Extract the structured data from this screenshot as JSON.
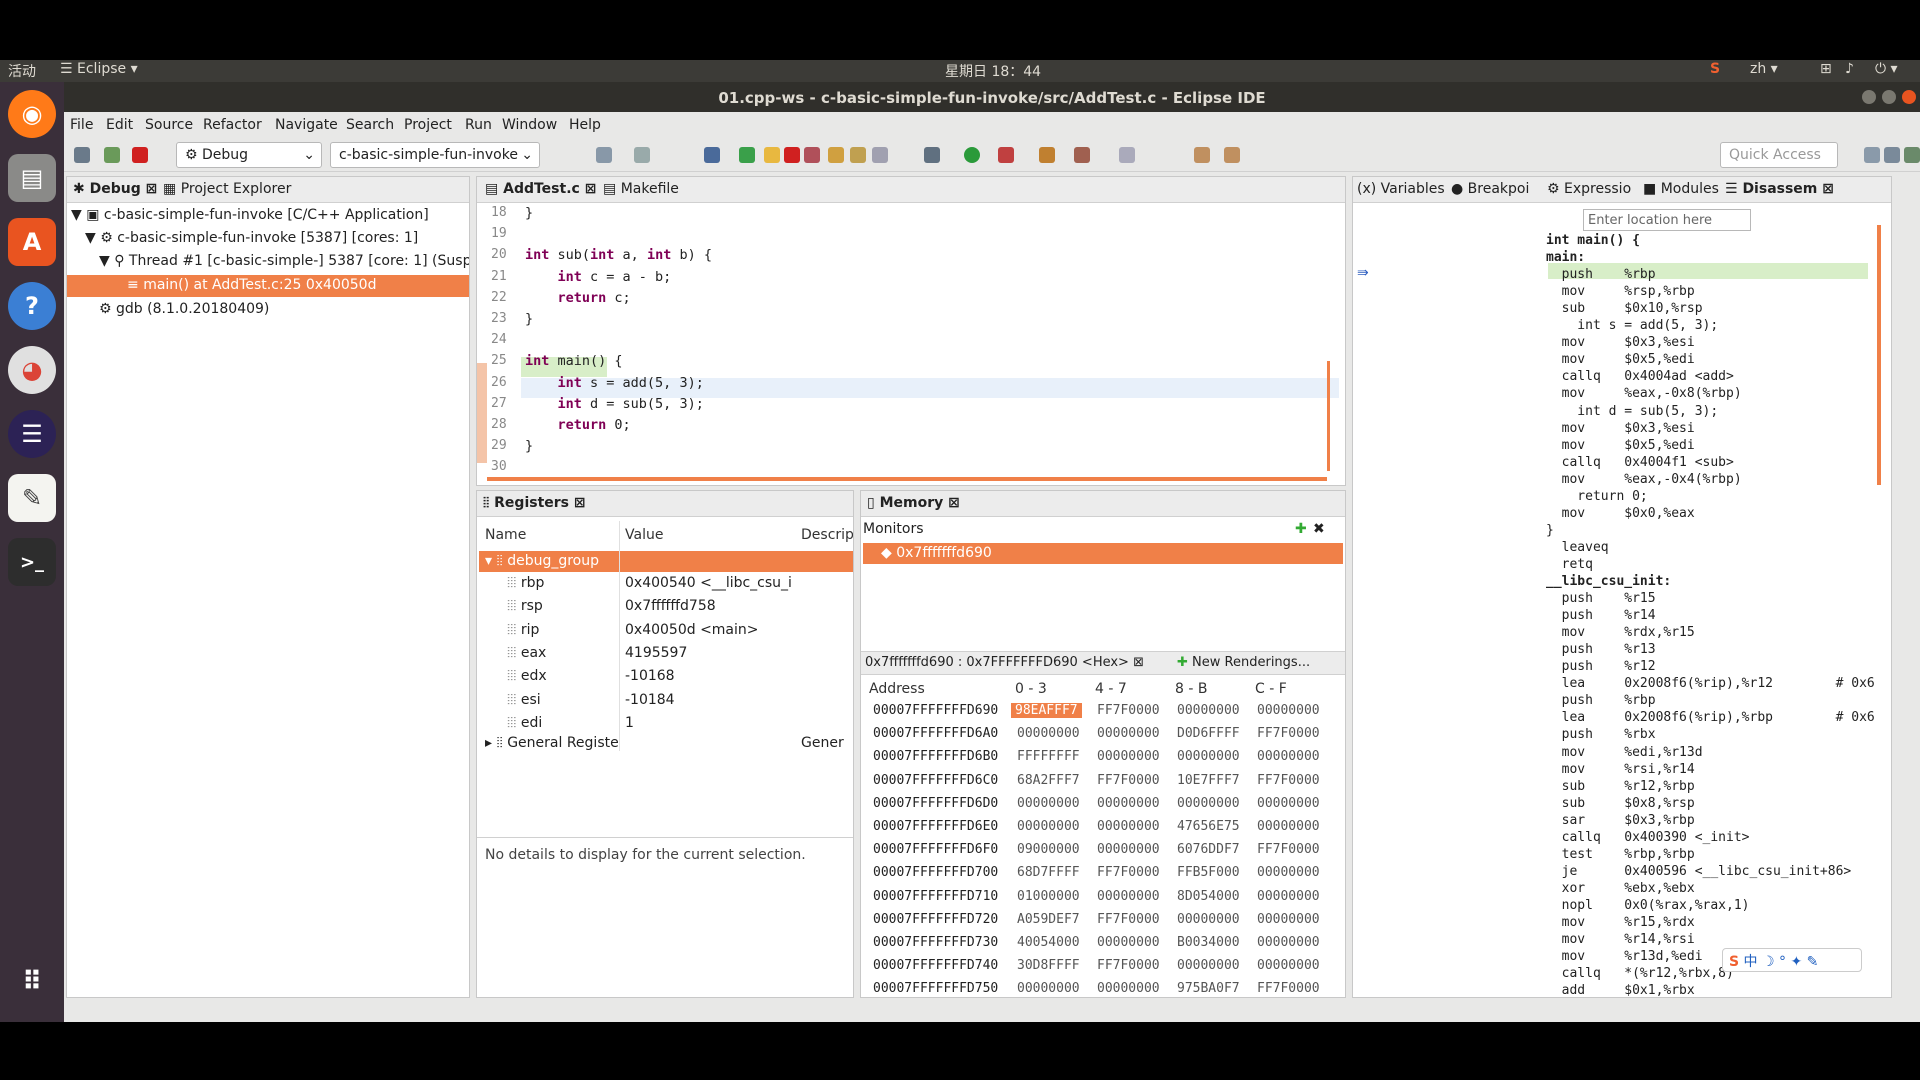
{
  "topbar": {
    "activities": "活动",
    "app": "Eclipse",
    "clock": "星期日 18：44",
    "lang": "zh"
  },
  "window": {
    "title": "01.cpp-ws - c-basic-simple-fun-invoke/src/AddTest.c - Eclipse IDE"
  },
  "menu": [
    "File",
    "Edit",
    "Source",
    "Refactor",
    "Navigate",
    "Search",
    "Project",
    "Run",
    "Window",
    "Help"
  ],
  "toolbar": {
    "launch_mode": "Debug",
    "launch_config": "c-basic-simple-fun-invoke",
    "quick_access": "Quick Access"
  },
  "debug_view": {
    "tabs": [
      "Debug",
      "Project Explorer"
    ],
    "items": [
      "c-basic-simple-fun-invoke [C/C++ Application]",
      "c-basic-simple-fun-invoke [5387] [cores: 1]",
      "Thread #1 [c-basic-simple-] 5387 [core: 1] (Suspend",
      "main() at AddTest.c:25 0x40050d",
      "gdb (8.1.0.20180409)"
    ]
  },
  "editor": {
    "tabs": [
      "AddTest.c",
      "Makefile"
    ],
    "line_numbers": [
      "18",
      "19",
      "20",
      "21",
      "22",
      "23",
      "24",
      "25",
      "26",
      "27",
      "28",
      "29",
      "30"
    ],
    "lines": [
      "}",
      "",
      "int sub(int a, int b) {",
      "    int c = a - b;",
      "    return c;",
      "}",
      "",
      "int main() {",
      "    int s = add(5, 3);",
      "    int d = sub(5, 3);",
      "    return 0;",
      "}",
      ""
    ]
  },
  "registers": {
    "tab": "Registers",
    "columns": [
      "Name",
      "Value",
      "Descrip"
    ],
    "group": "debug_group",
    "rows": [
      {
        "name": "rbp",
        "value": "0x400540 <__libc_csu_i"
      },
      {
        "name": "rsp",
        "value": "0x7ffffffd758"
      },
      {
        "name": "rip",
        "value": "0x40050d <main>"
      },
      {
        "name": "eax",
        "value": "4195597"
      },
      {
        "name": "edx",
        "value": "-10168"
      },
      {
        "name": "esi",
        "value": "-10184"
      },
      {
        "name": "edi",
        "value": "1"
      }
    ],
    "general": "General Registe",
    "general_desc": "Gener",
    "details": "No details to display for the current selection."
  },
  "memory": {
    "tab": "Memory",
    "monitors_label": "Monitors",
    "monitor": "0x7fffffffd690",
    "render_tab": "0x7fffffffd690 : 0x7FFFFFFFD690 <Hex>",
    "new_tab": "New Renderings...",
    "columns": [
      "Address",
      "0 - 3",
      "4 - 7",
      "8 - B",
      "C - F"
    ],
    "rows": [
      [
        "00007FFFFFFFD690",
        "98EAFFF7",
        "FF7F0000",
        "00000000",
        "00000000"
      ],
      [
        "00007FFFFFFFD6A0",
        "00000000",
        "00000000",
        "D0D6FFFF",
        "FF7F0000"
      ],
      [
        "00007FFFFFFFD6B0",
        "FFFFFFFF",
        "00000000",
        "00000000",
        "00000000"
      ],
      [
        "00007FFFFFFFD6C0",
        "68A2FFF7",
        "FF7F0000",
        "10E7FFF7",
        "FF7F0000"
      ],
      [
        "00007FFFFFFFD6D0",
        "00000000",
        "00000000",
        "00000000",
        "00000000"
      ],
      [
        "00007FFFFFFFD6E0",
        "00000000",
        "00000000",
        "47656E75",
        "00000000"
      ],
      [
        "00007FFFFFFFD6F0",
        "09000000",
        "00000000",
        "6076DDF7",
        "FF7F0000"
      ],
      [
        "00007FFFFFFFD700",
        "68D7FFFF",
        "FF7F0000",
        "FFB5F000",
        "00000000"
      ],
      [
        "00007FFFFFFFD710",
        "01000000",
        "00000000",
        "8D054000",
        "00000000"
      ],
      [
        "00007FFFFFFFD720",
        "A059DEF7",
        "FF7F0000",
        "00000000",
        "00000000"
      ],
      [
        "00007FFFFFFFD730",
        "40054000",
        "00000000",
        "B0034000",
        "00000000"
      ],
      [
        "00007FFFFFFFD740",
        "30D8FFFF",
        "FF7F0000",
        "00000000",
        "00000000"
      ],
      [
        "00007FFFFFFFD750",
        "00000000",
        "00000000",
        "975BA0F7",
        "FF7F0000"
      ]
    ]
  },
  "right_view": {
    "tabs": [
      "Variables",
      "Breakpoi",
      "Expressio",
      "Modules",
      "Disassem"
    ],
    "location_placeholder": "Enter location here",
    "lines": [
      "int main() {",
      "main:",
      "  push    %rbp",
      "  mov     %rsp,%rbp",
      "  sub     $0x10,%rsp",
      "    int s = add(5, 3);",
      "  mov     $0x3,%esi",
      "  mov     $0x5,%edi",
      "  callq   0x4004ad <add>",
      "  mov     %eax,-0x8(%rbp)",
      "    int d = sub(5, 3);",
      "  mov     $0x3,%esi",
      "  mov     $0x5,%edi",
      "  callq   0x4004f1 <sub>",
      "  mov     %eax,-0x4(%rbp)",
      "    return 0;",
      "  mov     $0x0,%eax",
      "}",
      "  leaveq",
      "  retq",
      "__libc_csu_init:",
      "  push    %r15",
      "  push    %r14",
      "  mov     %rdx,%r15",
      "  push    %r13",
      "  push    %r12",
      "  lea     0x2008f6(%rip),%r12        # 0x6",
      "  push    %rbp",
      "  lea     0x2008f6(%rip),%rbp        # 0x6",
      "  push    %rbx",
      "  mov     %edi,%r13d",
      "  mov     %rsi,%r14",
      "  sub     %r12,%rbp",
      "  sub     $0x8,%rsp",
      "  sar     $0x3,%rbp",
      "  callq   0x400390 <_init>",
      "  test    %rbp,%rbp",
      "  je      0x400596 <__libc_csu_init+86>",
      "  xor     %ebx,%ebx",
      "  nopl    0x0(%rax,%rax,1)",
      "  mov     %r15,%rdx",
      "  mov     %r14,%rsi",
      "  mov     %r13d,%edi",
      "  callq   *(%r12,%rbx,8)",
      "  add     $0x1,%rbx"
    ]
  },
  "ime": {
    "labels": [
      "中"
    ]
  },
  "colors": {
    "accent": "#f08048",
    "dock": "#3a2f3a",
    "topbar": "#3c3b37"
  }
}
